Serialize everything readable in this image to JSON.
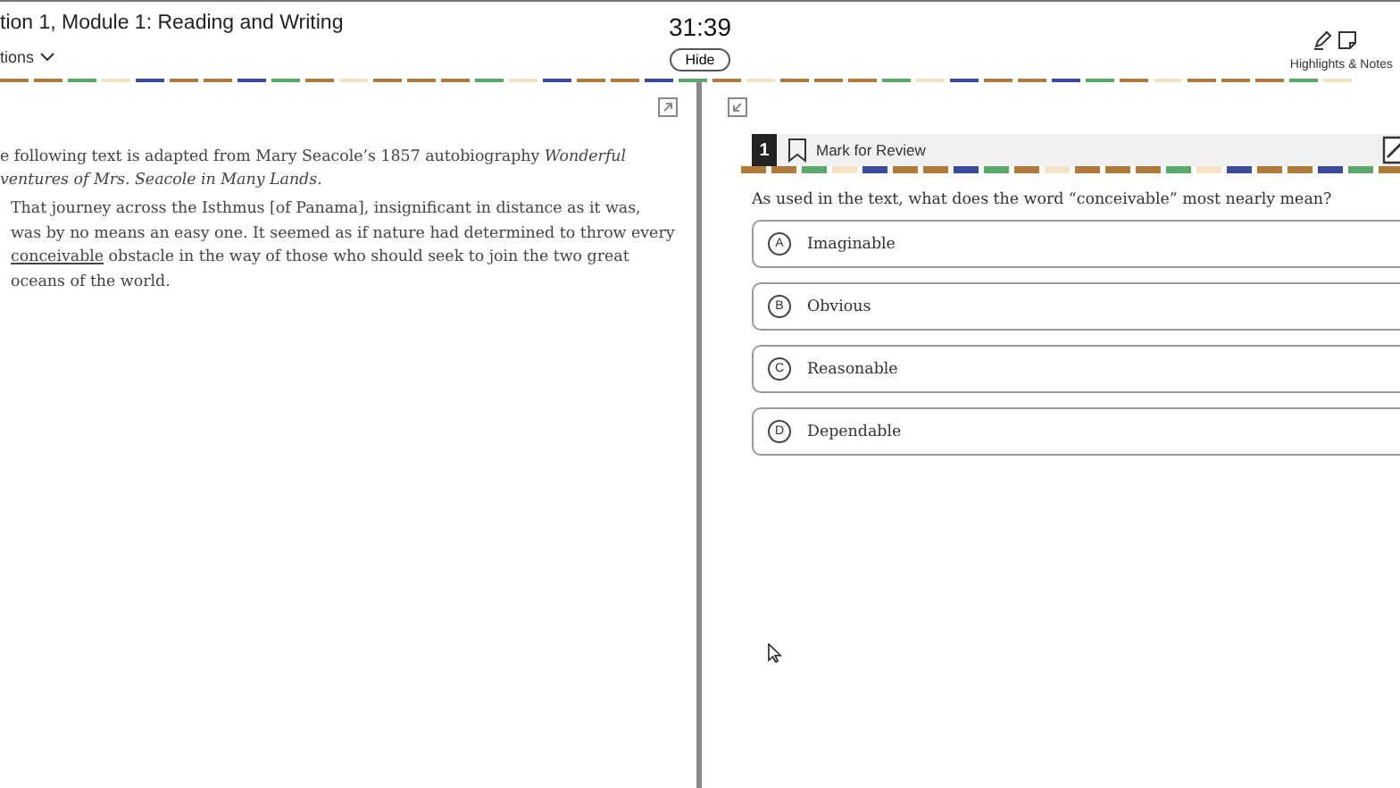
{
  "header": {
    "title": "tion 1, Module 1: Reading and Writing",
    "menu": "tions",
    "timer": "31:39",
    "hide_button": "Hide",
    "tools_label": "Highlights & Notes"
  },
  "passage": {
    "intro_lines": [
      "e following text is adapted from Mary Seacole’s 1857 autobiography *Wonderful*",
      "*ventures of Mrs. Seacole in Many Lands*."
    ],
    "before": "That journey across the Isthmus [of Panama], insignificant in distance as it was, was by no means an easy one. It seemed as if nature had determined to throw every ",
    "underlined": "conceivable",
    "after": " obstacle in the way of those who should seek to join the two great oceans of the world."
  },
  "question": {
    "number": "1",
    "marked": false,
    "mark_label": "Mark for Review",
    "prompt": "As used in the text, what does the word “conceivable” most nearly mean?",
    "choices": [
      {
        "letter": "A",
        "text": "Imaginable",
        "selected": false
      },
      {
        "letter": "B",
        "text": "Obvious",
        "selected": false
      },
      {
        "letter": "C",
        "text": "Reasonable",
        "selected": false
      },
      {
        "letter": "D",
        "text": "Dependable",
        "selected": false
      }
    ]
  }
}
